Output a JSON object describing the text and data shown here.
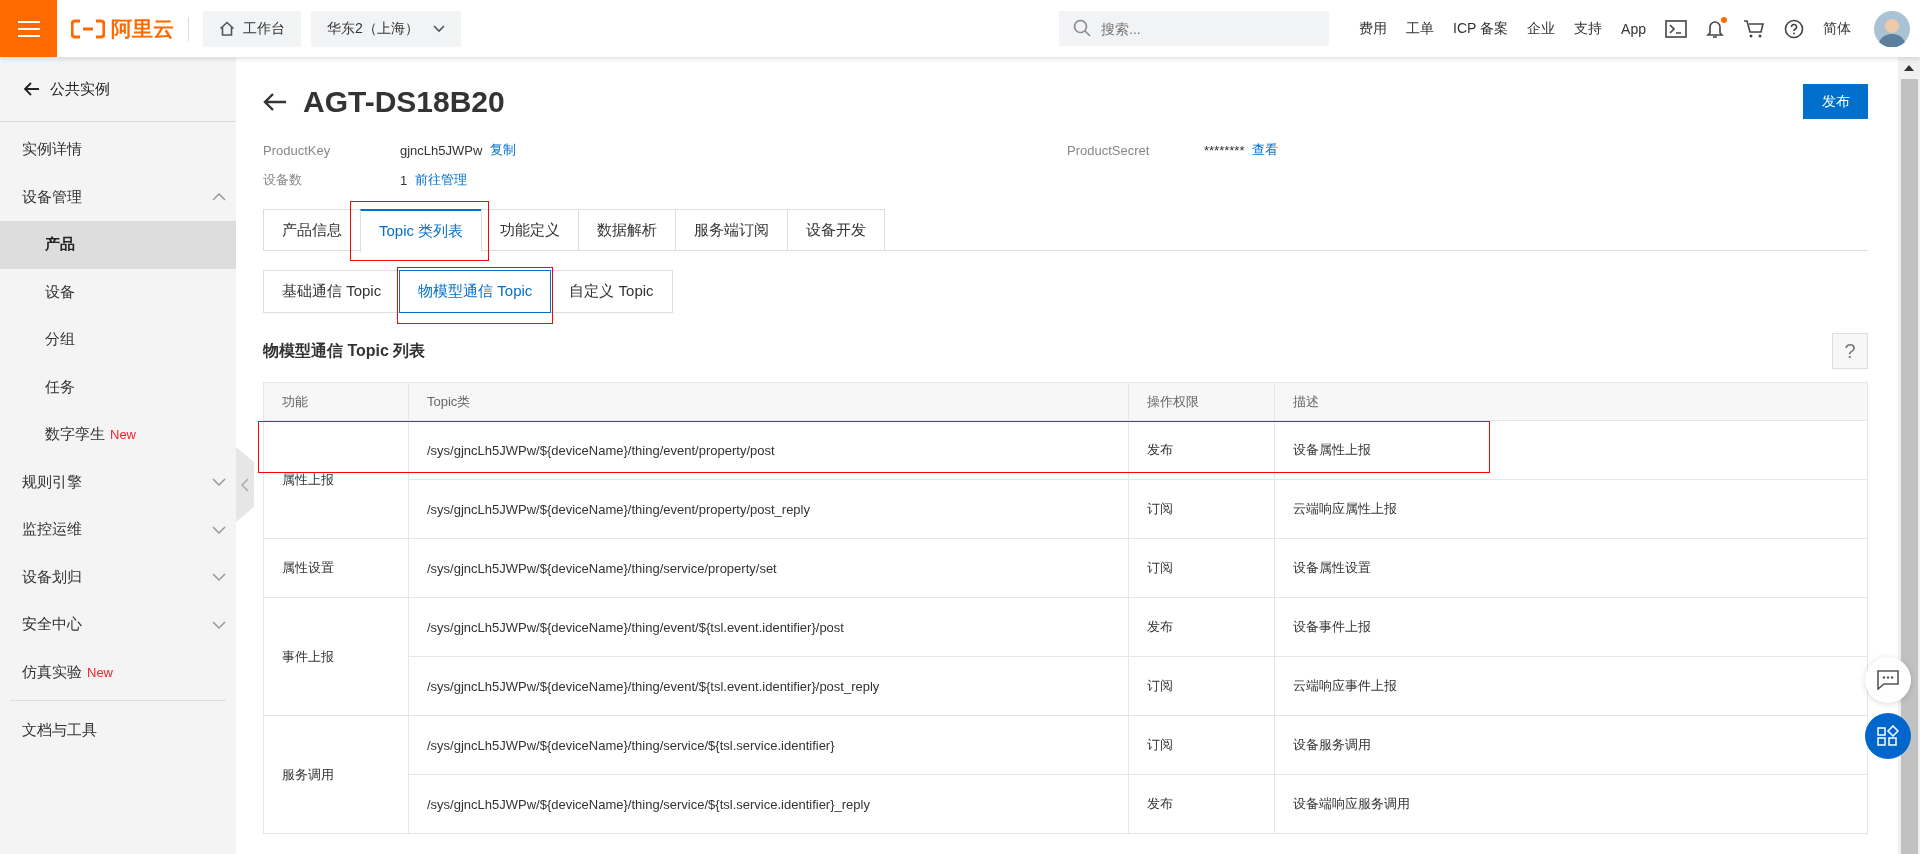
{
  "header": {
    "brand": "阿里云",
    "workbench": "工作台",
    "region": "华东2（上海）",
    "search": {
      "placeholder": "搜索..."
    },
    "links": [
      "费用",
      "工单",
      "ICP 备案",
      "企业",
      "支持",
      "App"
    ],
    "bell_dot": true,
    "language": "简体"
  },
  "sidebar": {
    "back": "公共实例",
    "items": [
      {
        "label": "实例详情",
        "kind": "link"
      },
      {
        "label": "设备管理",
        "kind": "group",
        "expanded": true,
        "children": [
          {
            "label": "产品",
            "selected": true
          },
          {
            "label": "设备",
            "selected": false
          },
          {
            "label": "分组",
            "selected": false
          },
          {
            "label": "任务",
            "selected": false
          },
          {
            "label": "数字孪生",
            "badge": "New",
            "selected": false
          }
        ]
      },
      {
        "label": "规则引擎",
        "kind": "group",
        "expanded": false
      },
      {
        "label": "监控运维",
        "kind": "group",
        "expanded": false
      },
      {
        "label": "设备划归",
        "kind": "group",
        "expanded": false
      },
      {
        "label": "安全中心",
        "kind": "group",
        "expanded": false
      },
      {
        "label": "仿真实验",
        "kind": "link",
        "badge": "New"
      },
      {
        "label": "文档与工具",
        "kind": "footer"
      }
    ]
  },
  "page": {
    "title": "AGT-DS18B20",
    "publish_button": "发布",
    "info": [
      {
        "label": "ProductKey",
        "value": "gjncLh5JWPw",
        "action": "复制"
      },
      {
        "label": "ProductSecret",
        "value": "********",
        "action": "查看"
      },
      {
        "label": "设备数",
        "value": "1",
        "action": "前往管理"
      }
    ],
    "tabs": [
      {
        "label": "产品信息",
        "selected": false,
        "annotated": false
      },
      {
        "label": "Topic 类列表",
        "selected": true,
        "annotated": true
      },
      {
        "label": "功能定义",
        "selected": false,
        "annotated": false
      },
      {
        "label": "数据解析",
        "selected": false,
        "annotated": false
      },
      {
        "label": "服务端订阅",
        "selected": false,
        "annotated": false
      },
      {
        "label": "设备开发",
        "selected": false,
        "annotated": false
      }
    ],
    "subtabs": [
      {
        "label": "基础通信 Topic",
        "selected": false,
        "annotated": false
      },
      {
        "label": "物模型通信 Topic",
        "selected": true,
        "annotated": true
      },
      {
        "label": "自定义 Topic",
        "selected": false,
        "annotated": false
      }
    ],
    "section_title": "物模型通信 Topic 列表",
    "help": "?",
    "table": {
      "columns": [
        "功能",
        "Topic类",
        "操作权限",
        "描述"
      ],
      "groups": [
        {
          "function": "属性上报",
          "rows": [
            {
              "topic": "/sys/gjncLh5JWPw/${deviceName}/thing/event/property/post",
              "permission": "发布",
              "description": "设备属性上报",
              "annotated": true
            },
            {
              "topic": "/sys/gjncLh5JWPw/${deviceName}/thing/event/property/post_reply",
              "permission": "订阅",
              "description": "云端响应属性上报",
              "annotated": false
            }
          ]
        },
        {
          "function": "属性设置",
          "rows": [
            {
              "topic": "/sys/gjncLh5JWPw/${deviceName}/thing/service/property/set",
              "permission": "订阅",
              "description": "设备属性设置",
              "annotated": false
            }
          ]
        },
        {
          "function": "事件上报",
          "rows": [
            {
              "topic": "/sys/gjncLh5JWPw/${deviceName}/thing/event/${tsl.event.identifier}/post",
              "permission": "发布",
              "description": "设备事件上报",
              "annotated": false
            },
            {
              "topic": "/sys/gjncLh5JWPw/${deviceName}/thing/event/${tsl.event.identifier}/post_reply",
              "permission": "订阅",
              "description": "云端响应事件上报",
              "annotated": false
            }
          ]
        },
        {
          "function": "服务调用",
          "rows": [
            {
              "topic": "/sys/gjncLh5JWPw/${deviceName}/thing/service/${tsl.service.identifier}",
              "permission": "订阅",
              "description": "设备服务调用",
              "annotated": false
            },
            {
              "topic": "/sys/gjncLh5JWPw/${deviceName}/thing/service/${tsl.service.identifier}_reply",
              "permission": "发布",
              "description": "设备端响应服务调用",
              "annotated": false
            }
          ]
        }
      ]
    }
  }
}
